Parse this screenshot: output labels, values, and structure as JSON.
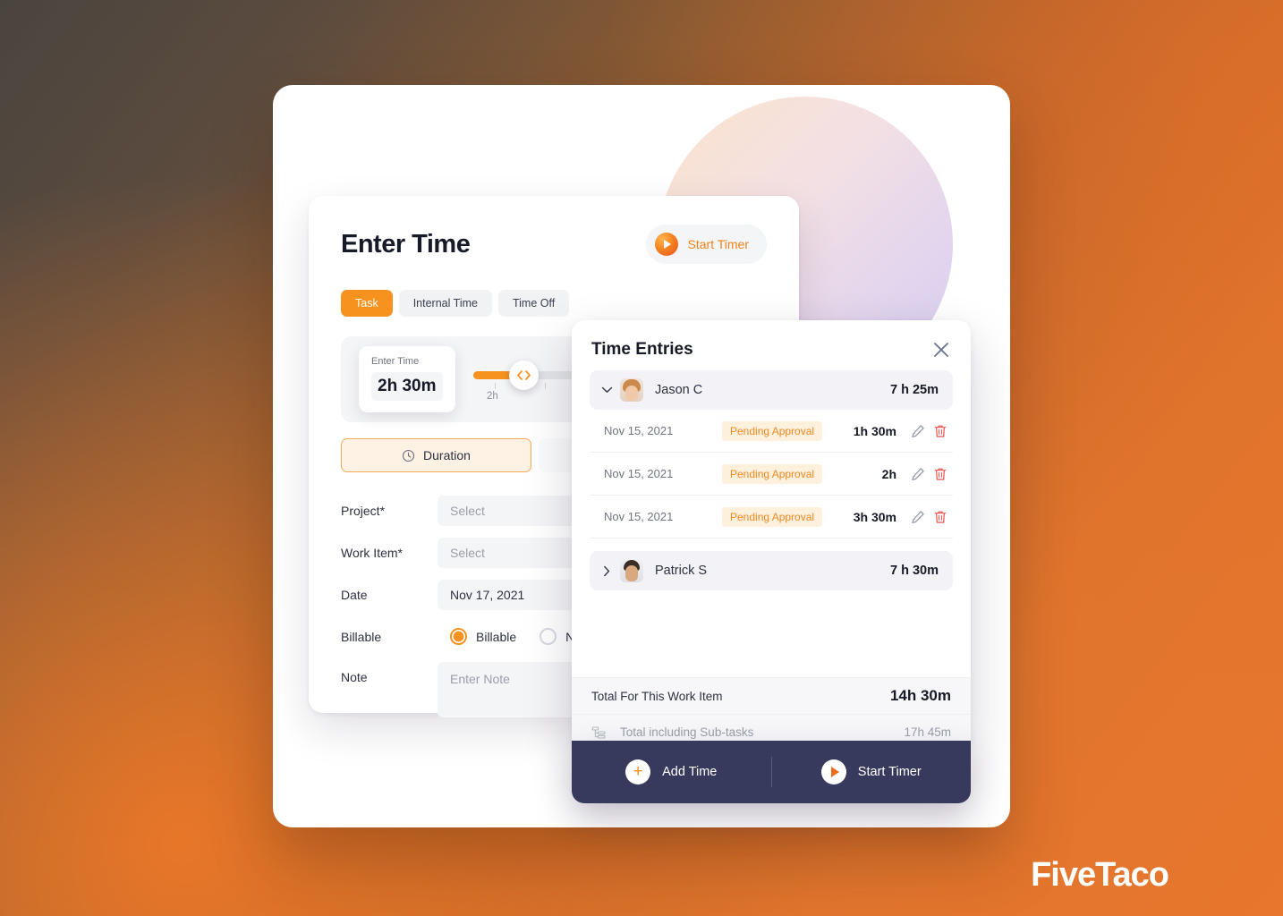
{
  "brand": {
    "name": "FiveTaco"
  },
  "theme": {
    "accent_orange": "#f7921e",
    "bg_orange": "#e8762c",
    "bg_dark": "#4a443f",
    "footer_navy": "#373a5c",
    "badge_text": "#ef8a1f",
    "badge_bg": "#fdf0dd",
    "delete_red": "#e8584f",
    "edit_gray": "#8d93ad"
  },
  "enter_time": {
    "title": "Enter Time",
    "start_timer": {
      "label": "Start Timer",
      "icon": "play-icon"
    },
    "tabs": [
      {
        "label": "Task",
        "active": true
      },
      {
        "label": "Internal Time",
        "active": false
      },
      {
        "label": "Time Off",
        "active": false
      }
    ],
    "slider": {
      "input_label": "Enter Time",
      "input_value": "2h 30m",
      "tick_label": "2h",
      "handle_icon": "resize-handle-icon"
    },
    "duration_button": {
      "label": "Duration",
      "icon": "clock-icon"
    },
    "fields": {
      "project": {
        "label": "Project*",
        "placeholder": "Select",
        "value": ""
      },
      "work_item": {
        "label": "Work Item*",
        "placeholder": "Select",
        "value": ""
      },
      "date": {
        "label": "Date",
        "value": "Nov 17, 2021",
        "chevron": "chevron-down-icon"
      },
      "billable": {
        "label": "Billable",
        "options": [
          {
            "label": "Billable",
            "selected": true
          },
          {
            "label": "N",
            "selected": false
          }
        ]
      },
      "note": {
        "label": "Note",
        "placeholder": "Enter Note",
        "value": ""
      }
    }
  },
  "time_entries": {
    "title": "Time Entries",
    "close_icon": "close-icon",
    "groups": [
      {
        "name": "Jason C",
        "total": "7 h 25m",
        "expanded": true,
        "caret": "chevron-down-icon",
        "avatar": "avatar-jason",
        "entries": [
          {
            "date": "Nov 15, 2021",
            "status": "Pending Approval",
            "duration": "1h 30m",
            "edit_icon": "pencil-icon",
            "delete_icon": "trash-icon"
          },
          {
            "date": "Nov 15, 2021",
            "status": "Pending Approval",
            "duration": "2h",
            "edit_icon": "pencil-icon",
            "delete_icon": "trash-icon"
          },
          {
            "date": "Nov 15, 2021",
            "status": "Pending Approval",
            "duration": "3h 30m",
            "edit_icon": "pencil-icon",
            "delete_icon": "trash-icon"
          }
        ]
      },
      {
        "name": "Patrick S",
        "total": "7 h 30m",
        "expanded": false,
        "caret": "chevron-right-icon",
        "avatar": "avatar-patrick",
        "entries": []
      }
    ],
    "totals": {
      "work_item_label": "Total For This Work Item",
      "work_item_value": "14h 30m",
      "subtasks_label": "Total including Sub-tasks",
      "subtasks_value": "17h 45m",
      "subtasks_icon": "subtask-tree-icon"
    },
    "footer": {
      "add_time": {
        "label": "Add Time",
        "icon": "plus-icon"
      },
      "start_timer": {
        "label": "Start Timer",
        "icon": "play-icon"
      }
    }
  }
}
